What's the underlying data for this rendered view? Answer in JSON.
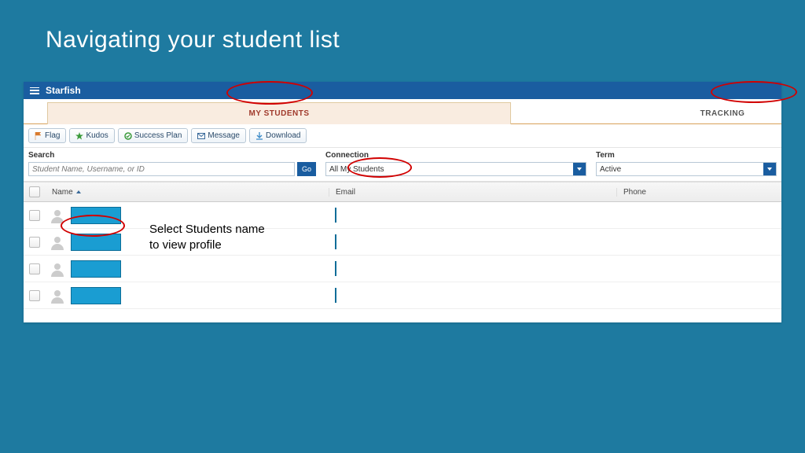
{
  "slide": {
    "title": "Navigating your student list"
  },
  "app": {
    "brand": "Starfish",
    "tabs": {
      "my_students": "MY STUDENTS",
      "tracking": "TRACKING"
    },
    "toolbar": {
      "flag": "Flag",
      "kudos": "Kudos",
      "success_plan": "Success Plan",
      "message": "Message",
      "download": "Download"
    },
    "filters": {
      "search_label": "Search",
      "search_placeholder": "Student Name, Username, or ID",
      "go": "Go",
      "connection_label": "Connection",
      "connection_value": "All My Students",
      "term_label": "Term",
      "term_value": "Active"
    },
    "columns": {
      "name": "Name",
      "email": "Email",
      "phone": "Phone"
    }
  },
  "annotation": {
    "line1": "Select Students name",
    "line2": "to view profile"
  }
}
